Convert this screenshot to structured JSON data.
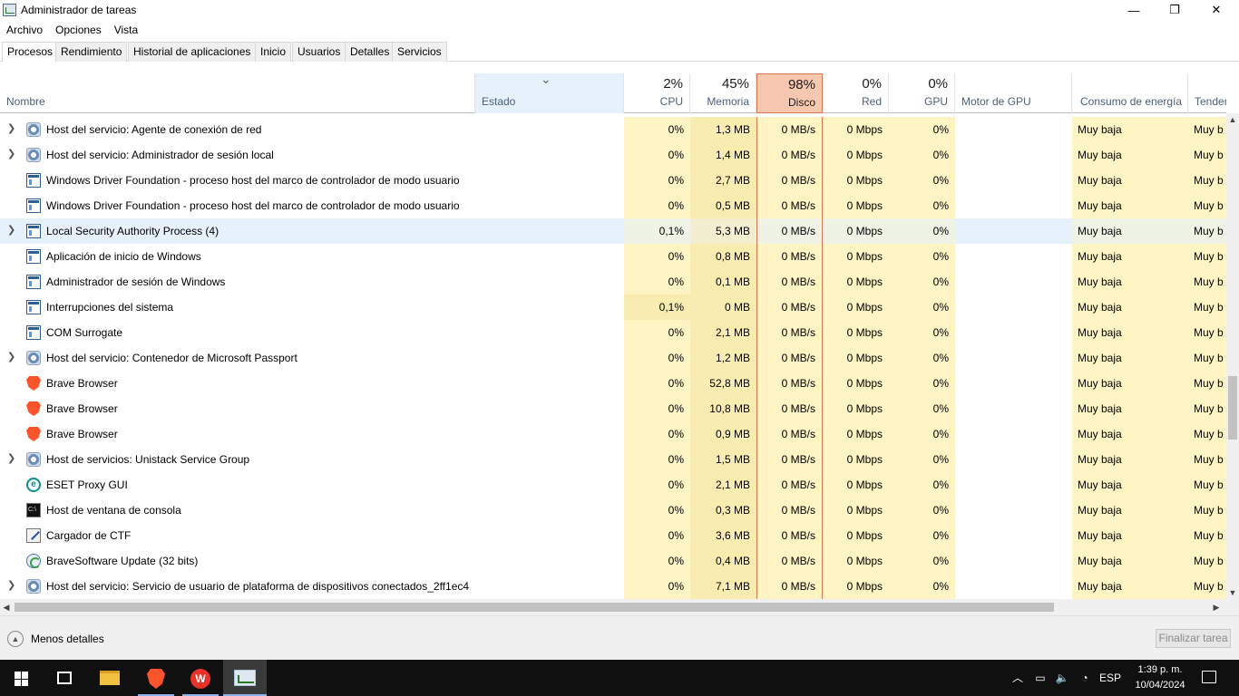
{
  "window": {
    "title": "Administrador de tareas",
    "controls": {
      "minimize": "—",
      "restore": "❐",
      "close": "✕"
    }
  },
  "menu": [
    "Archivo",
    "Opciones",
    "Vista"
  ],
  "tabs": [
    "Procesos",
    "Rendimiento",
    "Historial de aplicaciones",
    "Inicio",
    "Usuarios",
    "Detalles",
    "Servicios"
  ],
  "active_tab": "Procesos",
  "columns": {
    "name": {
      "label": "Nombre"
    },
    "status": {
      "label": "Estado",
      "sort_arrow": "⌄"
    },
    "cpu": {
      "pct": "2%",
      "label": "CPU"
    },
    "memory": {
      "pct": "45%",
      "label": "Memoria"
    },
    "disk": {
      "pct": "98%",
      "label": "Disco"
    },
    "network": {
      "pct": "0%",
      "label": "Red"
    },
    "gpu": {
      "pct": "0%",
      "label": "GPU"
    },
    "gpu_engine": {
      "label": "Motor de GPU"
    },
    "power": {
      "label": "Consumo de energía"
    },
    "power_trend": {
      "label": "Tendenci"
    }
  },
  "rows": [
    {
      "name": "Host del servicio: Agente de conexión de red",
      "icon": "gear-icon",
      "expandable": true,
      "cpu": "0%",
      "memory": "1,3 MB",
      "disk": "0 MB/s",
      "network": "0 Mbps",
      "gpu": "0%",
      "power": "Muy baja",
      "trend": "Muy b"
    },
    {
      "name": "Host del servicio: Administrador de sesión local",
      "icon": "gear-icon",
      "expandable": true,
      "cpu": "0%",
      "memory": "1,4 MB",
      "disk": "0 MB/s",
      "network": "0 Mbps",
      "gpu": "0%",
      "power": "Muy baja",
      "trend": "Muy b"
    },
    {
      "name": "Windows Driver Foundation - proceso host del marco de controlador de modo usuario",
      "icon": "window-icon",
      "expandable": false,
      "cpu": "0%",
      "memory": "2,7 MB",
      "disk": "0 MB/s",
      "network": "0 Mbps",
      "gpu": "0%",
      "power": "Muy baja",
      "trend": "Muy b"
    },
    {
      "name": "Windows Driver Foundation - proceso host del marco de controlador de modo usuario",
      "icon": "window-icon",
      "expandable": false,
      "cpu": "0%",
      "memory": "0,5 MB",
      "disk": "0 MB/s",
      "network": "0 Mbps",
      "gpu": "0%",
      "power": "Muy baja",
      "trend": "Muy b"
    },
    {
      "name": "Local Security Authority Process (4)",
      "icon": "window-icon",
      "expandable": true,
      "highlighted": true,
      "cpu": "0,1%",
      "memory": "5,3 MB",
      "disk": "0 MB/s",
      "network": "0 Mbps",
      "gpu": "0%",
      "power": "Muy baja",
      "trend": "Muy b"
    },
    {
      "name": "Aplicación de inicio de Windows",
      "icon": "window-icon",
      "expandable": false,
      "cpu": "0%",
      "memory": "0,8 MB",
      "disk": "0 MB/s",
      "network": "0 Mbps",
      "gpu": "0%",
      "power": "Muy baja",
      "trend": "Muy b"
    },
    {
      "name": "Administrador de sesión de Windows",
      "icon": "window-icon",
      "expandable": false,
      "cpu": "0%",
      "memory": "0,1 MB",
      "disk": "0 MB/s",
      "network": "0 Mbps",
      "gpu": "0%",
      "power": "Muy baja",
      "trend": "Muy b"
    },
    {
      "name": "Interrupciones del sistema",
      "icon": "window-icon",
      "expandable": false,
      "cpu": "0,1%",
      "memory": "0 MB",
      "disk": "0 MB/s",
      "network": "0 Mbps",
      "gpu": "0%",
      "power": "Muy baja",
      "trend": "Muy b"
    },
    {
      "name": "COM Surrogate",
      "icon": "window-icon",
      "expandable": false,
      "cpu": "0%",
      "memory": "2,1 MB",
      "disk": "0 MB/s",
      "network": "0 Mbps",
      "gpu": "0%",
      "power": "Muy baja",
      "trend": "Muy b"
    },
    {
      "name": "Host del servicio: Contenedor de Microsoft Passport",
      "icon": "gear-icon",
      "expandable": true,
      "cpu": "0%",
      "memory": "1,2 MB",
      "disk": "0 MB/s",
      "network": "0 Mbps",
      "gpu": "0%",
      "power": "Muy baja",
      "trend": "Muy b"
    },
    {
      "name": "Brave Browser",
      "icon": "brave-icon",
      "expandable": false,
      "cpu": "0%",
      "memory": "52,8 MB",
      "disk": "0 MB/s",
      "network": "0 Mbps",
      "gpu": "0%",
      "power": "Muy baja",
      "trend": "Muy b"
    },
    {
      "name": "Brave Browser",
      "icon": "brave-icon",
      "expandable": false,
      "cpu": "0%",
      "memory": "10,8 MB",
      "disk": "0 MB/s",
      "network": "0 Mbps",
      "gpu": "0%",
      "power": "Muy baja",
      "trend": "Muy b"
    },
    {
      "name": "Brave Browser",
      "icon": "brave-icon",
      "expandable": false,
      "cpu": "0%",
      "memory": "0,9 MB",
      "disk": "0 MB/s",
      "network": "0 Mbps",
      "gpu": "0%",
      "power": "Muy baja",
      "trend": "Muy b"
    },
    {
      "name": "Host de servicios: Unistack Service Group",
      "icon": "gear-icon",
      "expandable": true,
      "cpu": "0%",
      "memory": "1,5 MB",
      "disk": "0 MB/s",
      "network": "0 Mbps",
      "gpu": "0%",
      "power": "Muy baja",
      "trend": "Muy b"
    },
    {
      "name": "ESET Proxy GUI",
      "icon": "eset-icon",
      "expandable": false,
      "cpu": "0%",
      "memory": "2,1 MB",
      "disk": "0 MB/s",
      "network": "0 Mbps",
      "gpu": "0%",
      "power": "Muy baja",
      "trend": "Muy b"
    },
    {
      "name": "Host de ventana de consola",
      "icon": "console-icon",
      "expandable": false,
      "cpu": "0%",
      "memory": "0,3 MB",
      "disk": "0 MB/s",
      "network": "0 Mbps",
      "gpu": "0%",
      "power": "Muy baja",
      "trend": "Muy b"
    },
    {
      "name": "Cargador de CTF",
      "icon": "ctf-icon",
      "expandable": false,
      "cpu": "0%",
      "memory": "3,6 MB",
      "disk": "0 MB/s",
      "network": "0 Mbps",
      "gpu": "0%",
      "power": "Muy baja",
      "trend": "Muy b"
    },
    {
      "name": "BraveSoftware Update (32 bits)",
      "icon": "update-icon",
      "expandable": false,
      "cpu": "0%",
      "memory": "0,4 MB",
      "disk": "0 MB/s",
      "network": "0 Mbps",
      "gpu": "0%",
      "power": "Muy baja",
      "trend": "Muy b"
    },
    {
      "name": "Host del servicio: Servicio de usuario de plataforma de dispositivos conectados_2ff1ec4",
      "icon": "gear-icon",
      "expandable": true,
      "cpu": "0%",
      "memory": "7,1 MB",
      "disk": "0 MB/s",
      "network": "0 Mbps",
      "gpu": "0%",
      "power": "Muy baja",
      "trend": "Muy b"
    }
  ],
  "footer": {
    "less_details": "Menos detalles",
    "end_task": "Finalizar tarea"
  },
  "taskbar": {
    "language": "ESP",
    "time": "1:39 p. m.",
    "date": "10/04/2024",
    "wps_letter": "W"
  },
  "colors": {
    "heat_light": "#fff4c4",
    "heat_medium": "#f9ecb0",
    "disk_header": "#f8c7b0",
    "status_header": "#e6f1fb",
    "highlight_row": "#e6f1fb"
  }
}
